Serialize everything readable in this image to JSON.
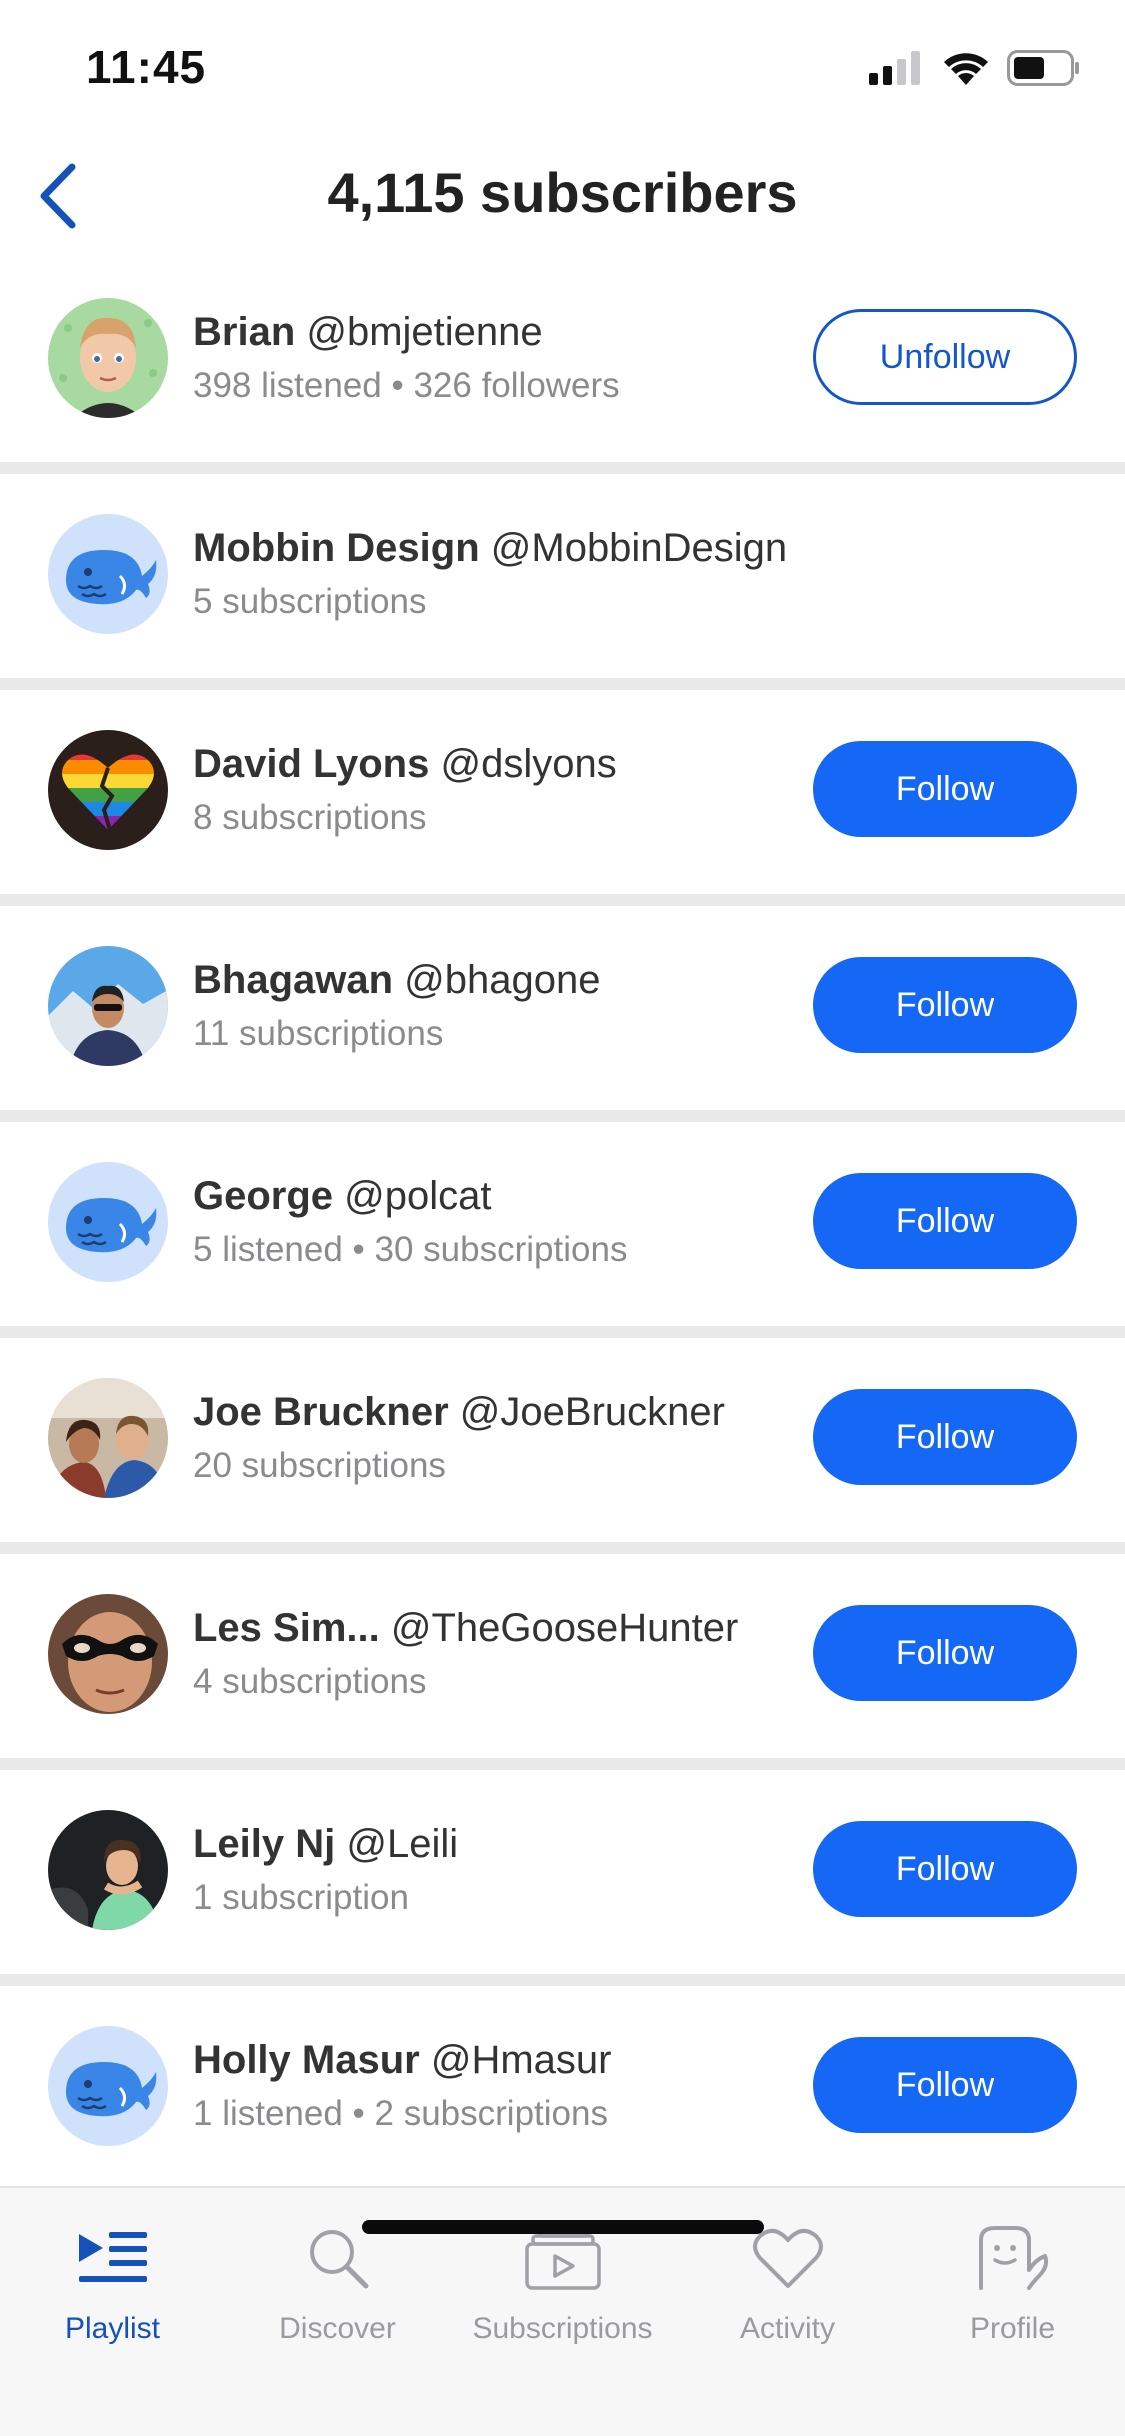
{
  "status_bar": {
    "time": "11:45"
  },
  "header": {
    "title": "4,115 subscribers"
  },
  "colors": {
    "accent": "#1468f5",
    "accent_dark": "#1451b8",
    "divider": "#e9e9ea"
  },
  "users": [
    {
      "name": "Brian",
      "handle": "@bmjetienne",
      "meta": "398 listened • 326 followers",
      "action": "Unfollow",
      "avatar": "cartoon-man-avatar"
    },
    {
      "name": "Mobbin Design",
      "handle": "@MobbinDesign",
      "meta": "5 subscriptions",
      "action": "",
      "avatar": "whale-avatar"
    },
    {
      "name": "David Lyons",
      "handle": "@dslyons",
      "meta": "8 subscriptions",
      "action": "Follow",
      "avatar": "rainbow-heart-avatar"
    },
    {
      "name": "Bhagawan",
      "handle": "@bhagone",
      "meta": "11 subscriptions",
      "action": "Follow",
      "avatar": "photo-avatar"
    },
    {
      "name": "George",
      "handle": "@polcat",
      "meta": "5 listened • 30 subscriptions",
      "action": "Follow",
      "avatar": "whale-avatar"
    },
    {
      "name": "Joe Bruckner",
      "handle": "@JoeBruckner",
      "meta": "20 subscriptions",
      "action": "Follow",
      "avatar": "photo-avatar"
    },
    {
      "name": "Les Sim...",
      "handle": "@TheGooseHunter",
      "meta": "4 subscriptions",
      "action": "Follow",
      "avatar": "masked-face-avatar"
    },
    {
      "name": "Leily Nj",
      "handle": "@Leili",
      "meta": "1 subscription",
      "action": "Follow",
      "avatar": "photo-avatar"
    },
    {
      "name": "Holly Masur",
      "handle": "@Hmasur",
      "meta": "1 listened • 2 subscriptions",
      "action": "Follow",
      "avatar": "whale-avatar"
    }
  ],
  "tabs": [
    {
      "label": "Playlist",
      "icon": "playlist-icon",
      "active": true
    },
    {
      "label": "Discover",
      "icon": "search-icon",
      "active": false
    },
    {
      "label": "Subscriptions",
      "icon": "subscriptions-icon",
      "active": false
    },
    {
      "label": "Activity",
      "icon": "heart-icon",
      "active": false
    },
    {
      "label": "Profile",
      "icon": "profile-icon",
      "active": false
    }
  ]
}
